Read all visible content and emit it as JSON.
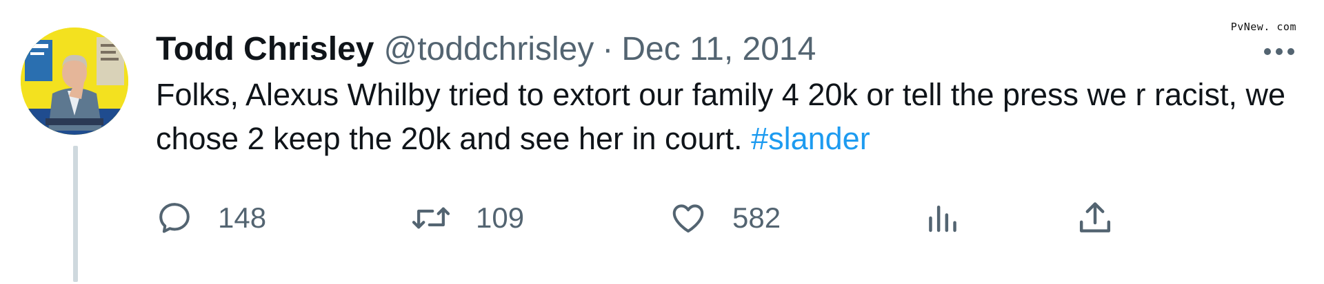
{
  "watermark": "PvNew. com",
  "author": {
    "name": "Todd Chrisley",
    "handle": "@toddchrisley",
    "separator": "·",
    "date": "Dec 11, 2014"
  },
  "tweet": {
    "text": "Folks, Alexus Whilby tried to extort our family 4 20k or tell the press we r racist, we chose 2 keep the 20k and see her in court. ",
    "hashtag": "#slander"
  },
  "actions": {
    "reply_count": "148",
    "retweet_count": "109",
    "like_count": "582"
  },
  "icons": {
    "reply": "reply-icon",
    "retweet": "retweet-icon",
    "like": "heart-icon",
    "views": "analytics-icon",
    "share": "share-icon",
    "more": "more-dots-icon"
  },
  "colors": {
    "text": "#0f1419",
    "secondary": "#536471",
    "link": "#1d9bf0",
    "thread_line": "#cfd9de"
  }
}
